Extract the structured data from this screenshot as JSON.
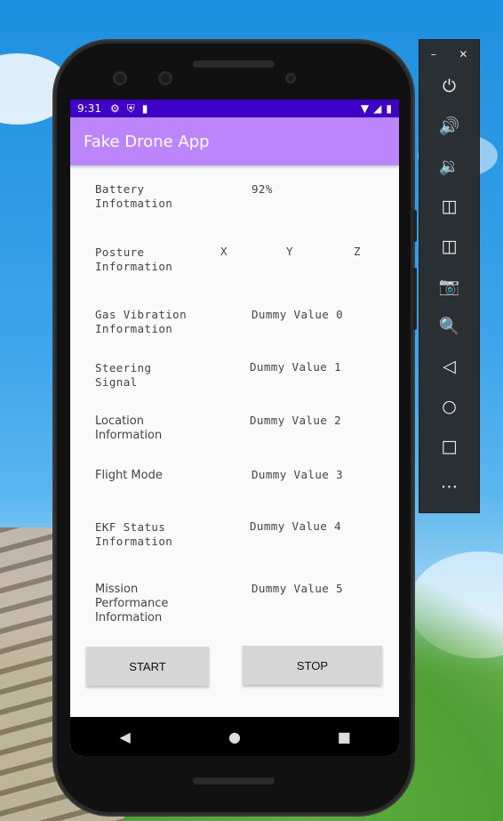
{
  "status_bar": {
    "time": "9:31"
  },
  "app": {
    "title": "Fake Drone App"
  },
  "rows": [
    {
      "label": "Battery\nInfotmation",
      "value": "92%"
    },
    {
      "label": "Posture\nInformation",
      "x": "X",
      "y": "Y",
      "z": "Z"
    },
    {
      "label": "Gas Vibration\nInformation",
      "value": "Dummy Value 0"
    },
    {
      "label": "Steering\nSignal",
      "value": "Dummy Value 1"
    },
    {
      "label": "Location\nInformation",
      "value": "Dummy Value 2"
    },
    {
      "label": "Flight Mode",
      "value": "Dummy Value 3"
    },
    {
      "label": "EKF Status\nInformation",
      "value": "Dummy Value 4"
    },
    {
      "label": "Mission\nPerformance\nInformation",
      "value": "Dummy Value 5"
    }
  ],
  "buttons": {
    "start": "START",
    "stop": "STOP"
  },
  "colors": {
    "status_bar": "#3f00c8",
    "app_bar": "#bb86fc",
    "button": "#d6d6d6"
  },
  "toolbar_icons": [
    "power-icon",
    "volume-up-icon",
    "volume-down-icon",
    "rotate-left-icon",
    "rotate-right-icon",
    "camera-icon",
    "zoom-icon",
    "back-icon",
    "home-icon",
    "overview-icon",
    "more-icon"
  ]
}
